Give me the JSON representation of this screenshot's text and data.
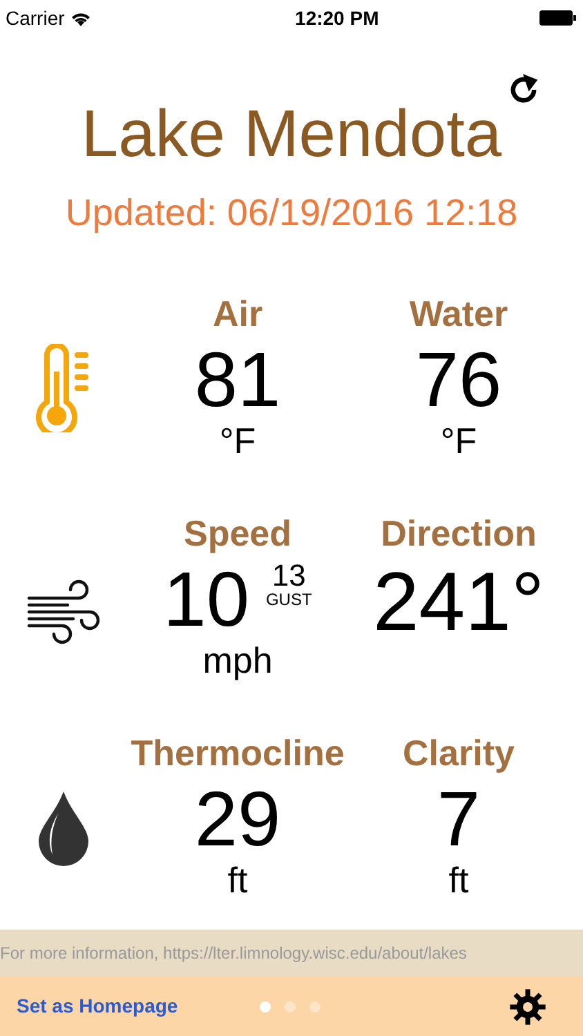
{
  "status_bar": {
    "carrier": "Carrier",
    "time": "12:20 PM"
  },
  "title": "Lake Mendota",
  "updated": "Updated: 06/19/2016 12:18",
  "rows": [
    {
      "kind": "temperature",
      "cells": [
        {
          "label": "Air",
          "value": "81",
          "unit": "°F"
        },
        {
          "label": "Water",
          "value": "76",
          "unit": "°F"
        }
      ]
    },
    {
      "kind": "wind",
      "cells": [
        {
          "label": "Speed",
          "value": "10",
          "unit": "mph",
          "gust_value": "13",
          "gust_label": "GUST"
        },
        {
          "label": "Direction",
          "value": "241°"
        }
      ]
    },
    {
      "kind": "water",
      "cells": [
        {
          "label": "Thermocline",
          "value": "29",
          "unit": "ft"
        },
        {
          "label": "Clarity",
          "value": "7",
          "unit": "ft"
        }
      ]
    }
  ],
  "info": "For more information, https://lter.limnology.wisc.edu/about/lakes",
  "homepage_link": "Set as Homepage",
  "page_dots": [
    {
      "selected": true
    },
    {
      "selected": false
    },
    {
      "selected": false
    }
  ]
}
